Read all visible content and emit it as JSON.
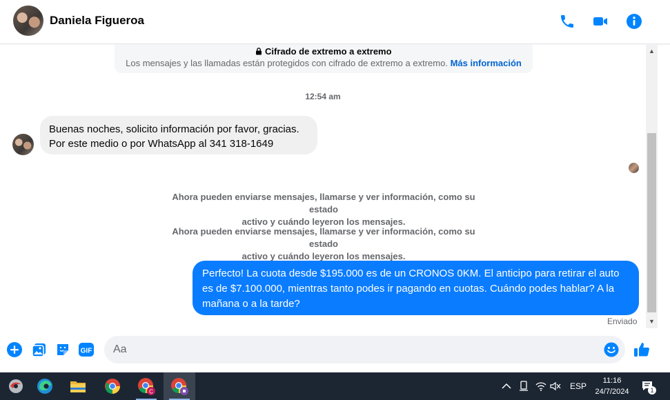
{
  "header": {
    "contact_name": "Daniela Figueroa",
    "icons": [
      "phone-icon",
      "video-icon",
      "info-icon"
    ],
    "accent_color": "#0084ff"
  },
  "encryption": {
    "title": "Cifrado de extremo a extremo",
    "text": "Los mensajes y las llamadas están protegidos con cifrado de extremo a extremo.",
    "link": "Más información"
  },
  "chat": {
    "timestamp": "12:54 am",
    "incoming": {
      "line1": "Buenas noches, solicito información por favor, gracias.",
      "line2": "Por este medio o por WhatsApp al 341 318-1649"
    },
    "system_messages": [
      {
        "line1": "Ahora pueden enviarse mensajes, llamarse y ver información, como su estado",
        "line2": "activo y cuándo leyeron los mensajes."
      },
      {
        "line1": "Ahora pueden enviarse mensajes, llamarse y ver información, como su estado",
        "line2": "activo y cuándo leyeron los mensajes."
      }
    ],
    "outgoing": {
      "text": "Perfecto! La cuota desde $195.000 es de un CRONOS 0KM. El anticipo para retirar el auto es de $7.100.000, mientras tanto podes ir pagando en cuotas. Cuándo podes hablar? A la mañana o a la tarde?",
      "color": "#0a7cff"
    },
    "status": "Enviado"
  },
  "composer": {
    "placeholder": "Aa",
    "icons": [
      "plus-icon",
      "image-icon",
      "sticker-icon",
      "gif-icon",
      "emoji-icon",
      "like-icon"
    ],
    "gif_label": "GIF"
  },
  "taskbar": {
    "apps": [
      "app-launcher-icon",
      "edge-icon",
      "file-explorer-icon",
      "chrome-icon",
      "chrome-profile-icon",
      "chrome-profile-2-icon"
    ],
    "language": "ESP",
    "time": "11:16",
    "date": "24/7/2024",
    "notification_count": "1"
  }
}
